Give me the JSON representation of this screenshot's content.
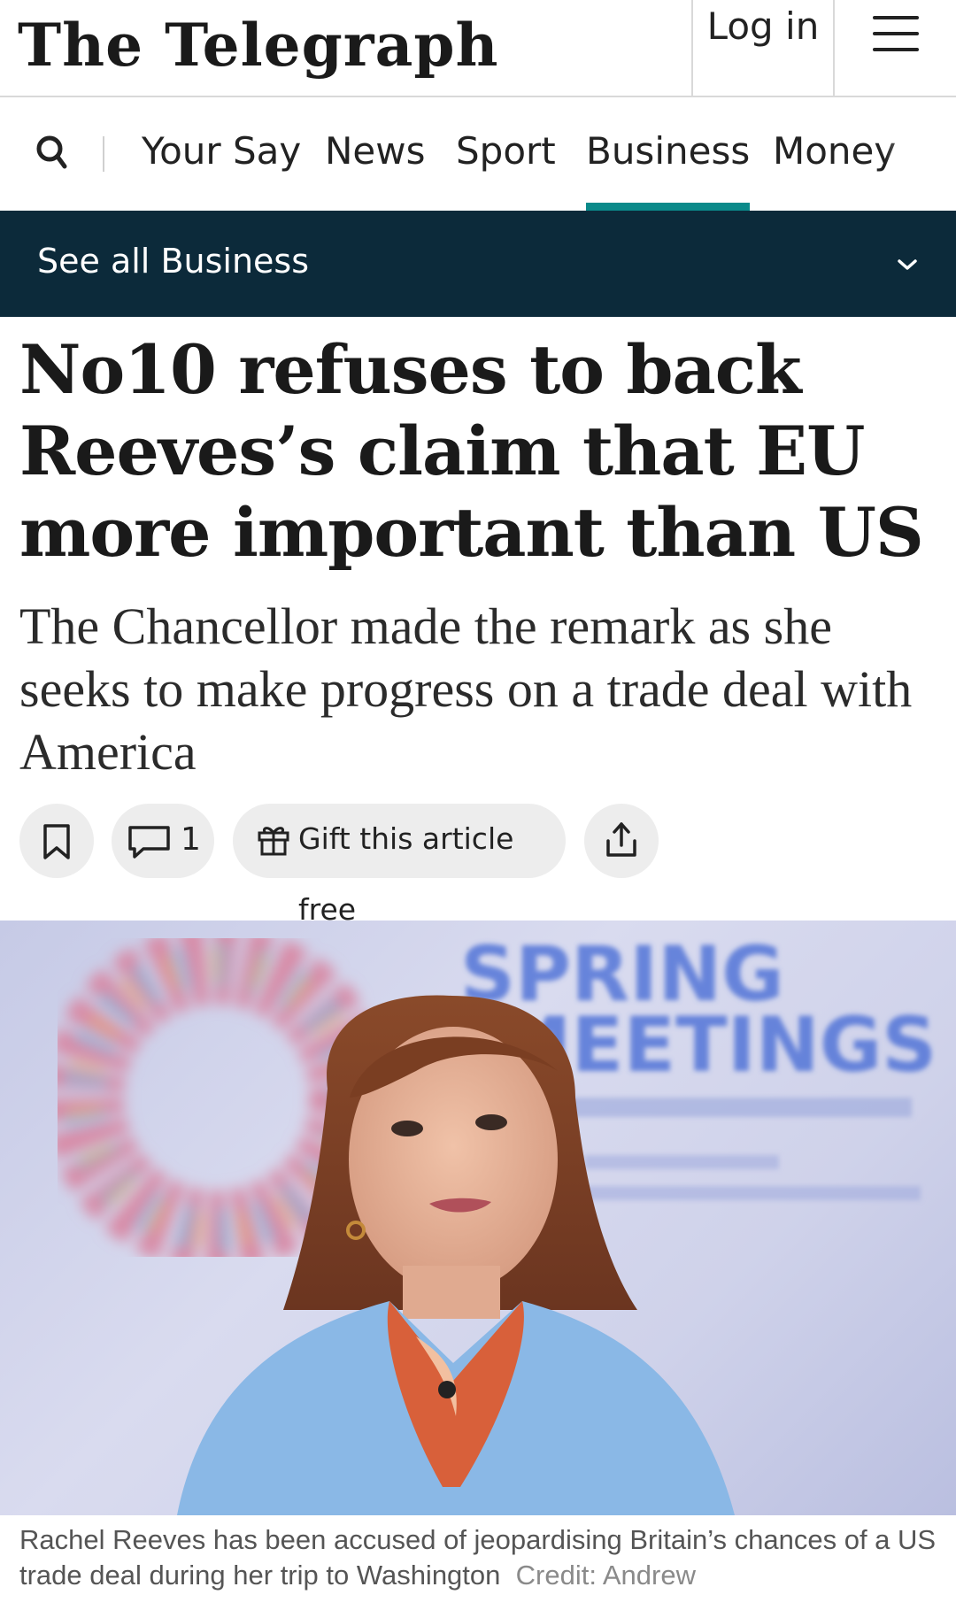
{
  "header": {
    "logo": "The Telegraph",
    "login_label": "Log in",
    "menu_icon": "hamburger-menu-icon"
  },
  "nav": {
    "search_icon": "search-icon",
    "items": [
      {
        "label": "Your Say"
      },
      {
        "label": "News"
      },
      {
        "label": "Sport"
      },
      {
        "label": "Business",
        "active": true
      },
      {
        "label": "Money"
      }
    ],
    "active_color": "#0b8a8a"
  },
  "section_bar": {
    "label": "See all Business",
    "icon": "chevron-down-icon",
    "background": "#0c2a3a"
  },
  "article": {
    "headline": "No10 refuses to back Reeves’s claim that EU more important than US",
    "standfirst": "The Chancellor made the remark as she seeks to make progress on a trade deal with America",
    "actions": {
      "bookmark_icon": "bookmark-icon",
      "comment_icon": "comment-icon",
      "comment_count": "1",
      "gift_icon": "gift-icon",
      "gift_label": "Gift this article free",
      "share_icon": "share-icon"
    },
    "image": {
      "sign_line1": "SPRING",
      "sign_line2": "MEETINGS"
    },
    "caption": "Rachel Reeves has been accused of jeopardising Britain’s chances of a US trade deal during her trip to Washington",
    "credit": "Credit: Andrew"
  }
}
